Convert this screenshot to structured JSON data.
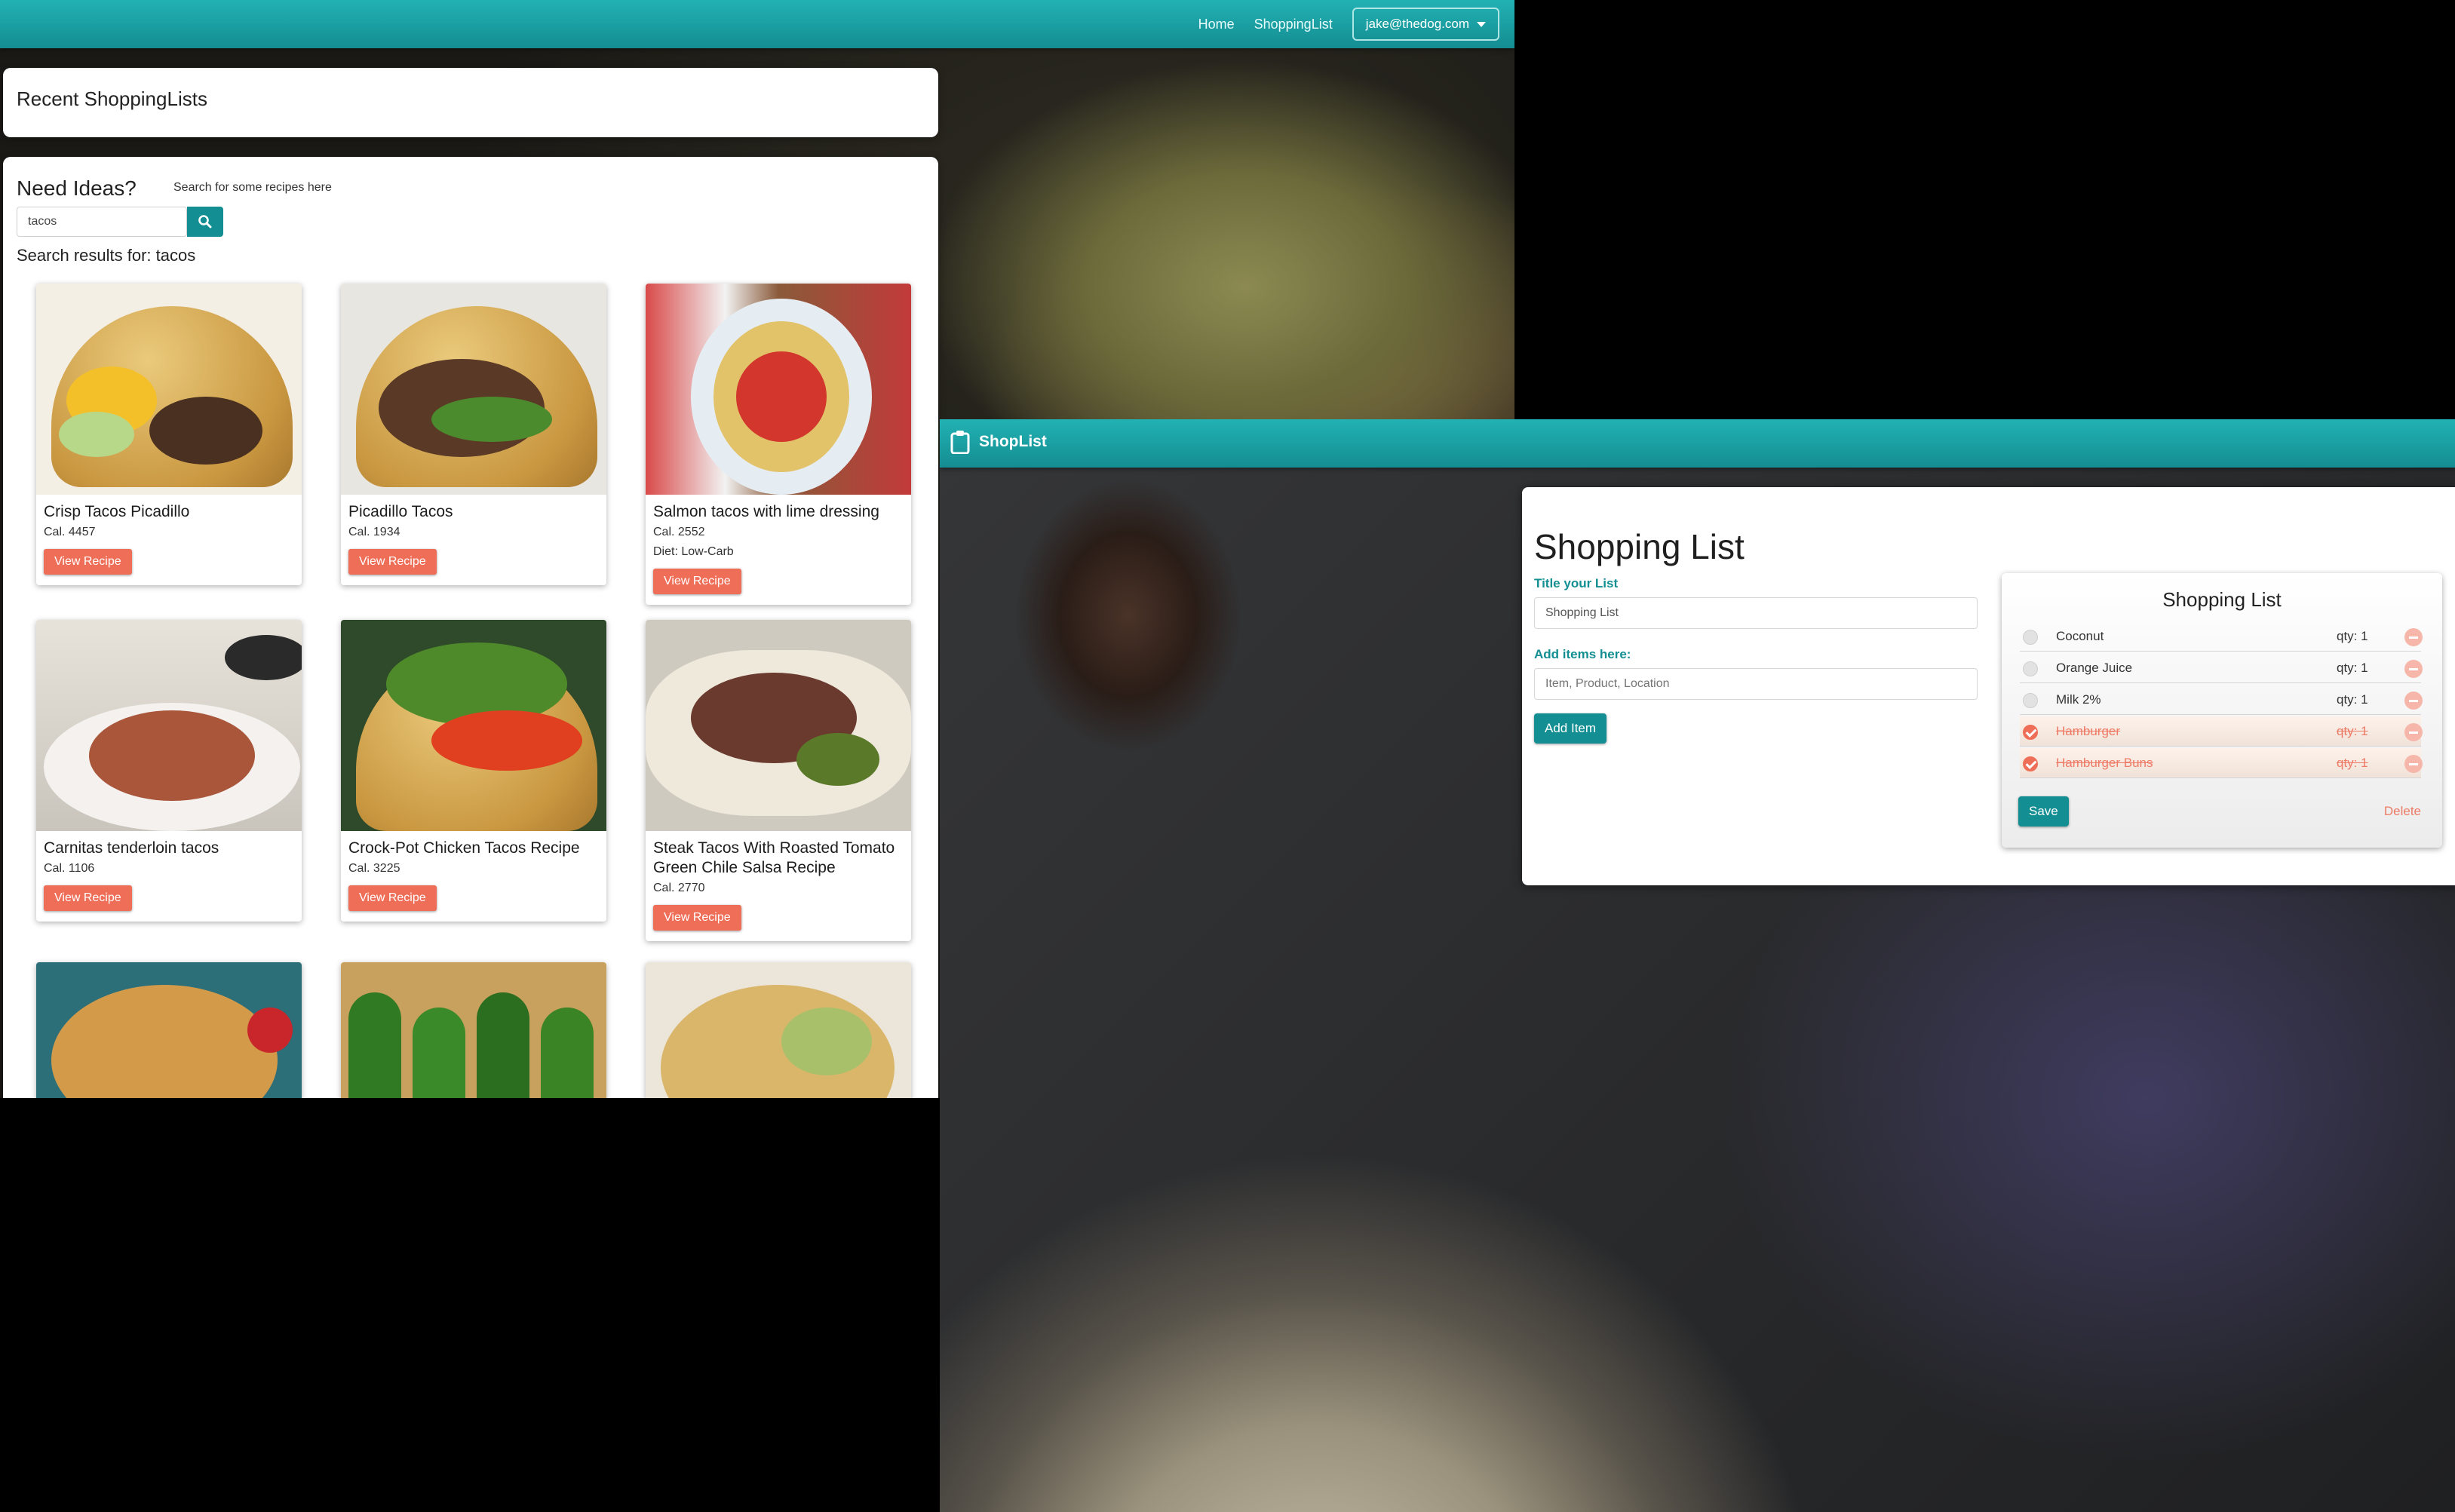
{
  "left_window": {
    "nav": {
      "home": "Home",
      "shopping_list": "ShoppingList",
      "user": "jake@thedog.com"
    },
    "recent_title": "Recent ShoppingLists",
    "ideas": {
      "title": "Need Ideas?",
      "hint": "Search for some recipes here",
      "search_value": "tacos",
      "results_label": "Search results for: tacos"
    },
    "recipes": [
      {
        "title": "Crisp Tacos Picadillo",
        "cal": "Cal. 4457",
        "diet": "",
        "button": "View Recipe"
      },
      {
        "title": "Picadillo Tacos",
        "cal": "Cal. 1934",
        "diet": "",
        "button": "View Recipe"
      },
      {
        "title": "Salmon tacos with lime dressing",
        "cal": "Cal. 2552",
        "diet": "Diet: Low-Carb",
        "button": "View Recipe"
      },
      {
        "title": "Carnitas tenderloin tacos",
        "cal": "Cal. 1106",
        "diet": "",
        "button": "View Recipe"
      },
      {
        "title": "Crock-Pot Chicken Tacos Recipe",
        "cal": "Cal. 3225",
        "diet": "",
        "button": "View Recipe"
      },
      {
        "title": "Steak Tacos With Roasted Tomato Green Chile Salsa Recipe",
        "cal": "Cal. 2770",
        "diet": "",
        "button": "View Recipe"
      }
    ]
  },
  "right_window": {
    "brand": "ShopList",
    "panel_title": "Shopping List",
    "title_label": "Title your List",
    "title_value": "Shopping List",
    "items_label": "Add items here:",
    "items_placeholder": "Item, Product, Location",
    "add_button": "Add Item",
    "list": {
      "title": "Shopping List",
      "items": [
        {
          "name": "Coconut",
          "qty": "qty: 1",
          "done": false
        },
        {
          "name": "Orange Juice",
          "qty": "qty: 1",
          "done": false
        },
        {
          "name": "Milk 2%",
          "qty": "qty: 1",
          "done": false
        },
        {
          "name": "Hamburger",
          "qty": "qty: 1",
          "done": true
        },
        {
          "name": "Hamburger Buns",
          "qty": "qty: 1",
          "done": true
        }
      ],
      "save": "Save",
      "delete": "Delete"
    }
  },
  "colors": {
    "teal": "#138e92",
    "salmon": "#ee6e58"
  }
}
